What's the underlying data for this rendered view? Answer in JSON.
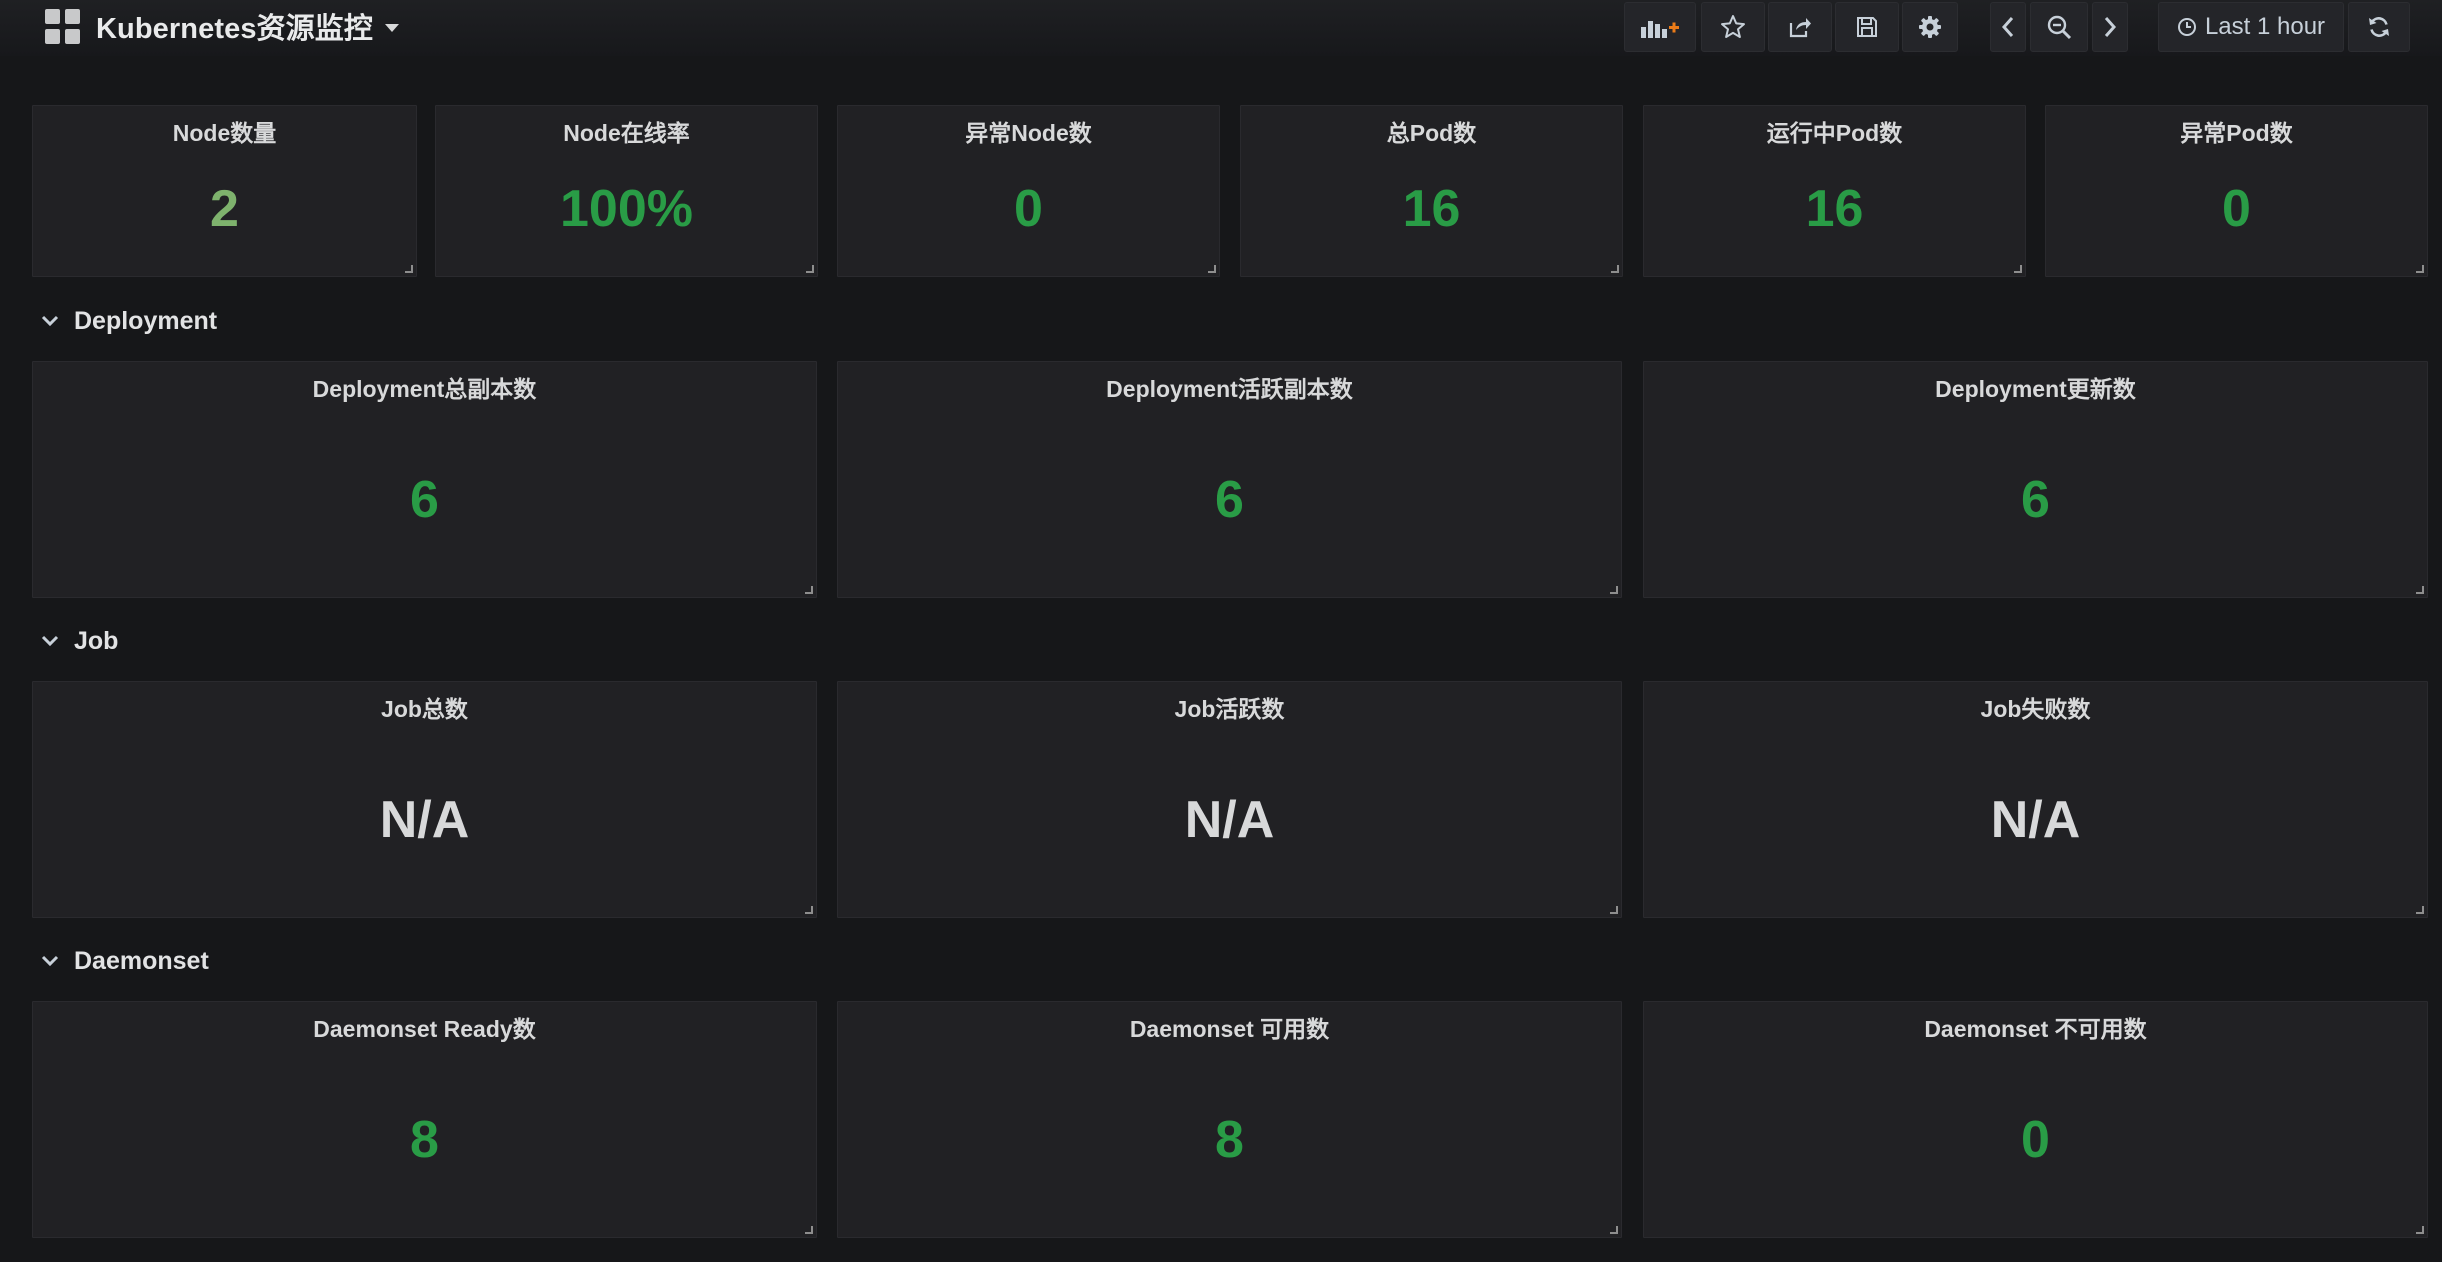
{
  "header": {
    "title": "Kubernetes资源监控",
    "time_range": "Last 1 hour"
  },
  "toolbar": {
    "icons": [
      "add-panel-icon",
      "star-icon",
      "share-icon",
      "save-icon",
      "gear-icon",
      "chevron-left-icon",
      "zoom-out-icon",
      "chevron-right-icon",
      "clock-icon",
      "refresh-icon"
    ]
  },
  "colors": {
    "background": "#161719",
    "panel": "#212124",
    "value_green": "#299c46",
    "value_light_green": "#7eb26d",
    "value_na": "#d8d9da"
  },
  "top_stats": [
    {
      "title": "Node数量",
      "value": "2"
    },
    {
      "title": "Node在线率",
      "value": "100%"
    },
    {
      "title": "异常Node数",
      "value": "0"
    },
    {
      "title": "总Pod数",
      "value": "16"
    },
    {
      "title": "运行中Pod数",
      "value": "16"
    },
    {
      "title": "异常Pod数",
      "value": "0"
    }
  ],
  "rows": [
    {
      "title": "Deployment",
      "panels": [
        {
          "title": "Deployment总副本数",
          "value": "6"
        },
        {
          "title": "Deployment活跃副本数",
          "value": "6"
        },
        {
          "title": "Deployment更新数",
          "value": "6"
        }
      ]
    },
    {
      "title": "Job",
      "panels": [
        {
          "title": "Job总数",
          "value": "N/A"
        },
        {
          "title": "Job活跃数",
          "value": "N/A"
        },
        {
          "title": "Job失败数",
          "value": "N/A"
        }
      ]
    },
    {
      "title": "Daemonset",
      "panels": [
        {
          "title": "Daemonset Ready数",
          "value": "8"
        },
        {
          "title": "Daemonset 可用数",
          "value": "8"
        },
        {
          "title": "Daemonset 不可用数",
          "value": "0"
        }
      ]
    }
  ]
}
